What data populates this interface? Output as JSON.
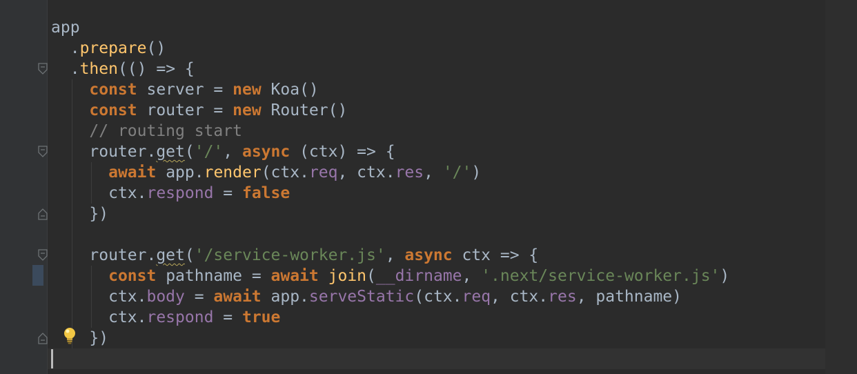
{
  "editor": {
    "theme_colors": {
      "background": "#2b2b2b",
      "gutter": "#313335",
      "keyword": "#cc7832",
      "function": "#ffc66d",
      "string": "#6a8759",
      "property": "#9876aa",
      "comment": "#808080",
      "default": "#a9b7c6"
    },
    "lines": [
      {
        "indent": "",
        "tokens": [
          {
            "t": "app",
            "c": ""
          }
        ]
      },
      {
        "indent": "  ",
        "tokens": [
          {
            "t": ".",
            "c": ""
          },
          {
            "t": "prepare",
            "c": "fn"
          },
          {
            "t": "()",
            "c": ""
          }
        ]
      },
      {
        "indent": "  ",
        "tokens": [
          {
            "t": ".",
            "c": ""
          },
          {
            "t": "then",
            "c": "fn"
          },
          {
            "t": "(() => {",
            "c": ""
          }
        ]
      },
      {
        "indent": "    ",
        "tokens": [
          {
            "t": "const",
            "c": "kw"
          },
          {
            "t": " server = ",
            "c": ""
          },
          {
            "t": "new",
            "c": "kw"
          },
          {
            "t": " Koa()",
            "c": ""
          }
        ]
      },
      {
        "indent": "    ",
        "tokens": [
          {
            "t": "const",
            "c": "kw"
          },
          {
            "t": " router = ",
            "c": ""
          },
          {
            "t": "new",
            "c": "kw"
          },
          {
            "t": " Router()",
            "c": ""
          }
        ]
      },
      {
        "indent": "    ",
        "tokens": [
          {
            "t": "// routing start",
            "c": "cm"
          }
        ]
      },
      {
        "indent": "    ",
        "tokens": [
          {
            "t": "router.",
            "c": ""
          },
          {
            "t": "get",
            "c": "squig"
          },
          {
            "t": "(",
            "c": ""
          },
          {
            "t": "'/'",
            "c": "str"
          },
          {
            "t": ", ",
            "c": ""
          },
          {
            "t": "async",
            "c": "kw"
          },
          {
            "t": " (ctx) => {",
            "c": ""
          }
        ]
      },
      {
        "indent": "      ",
        "tokens": [
          {
            "t": "await",
            "c": "kw"
          },
          {
            "t": " app.",
            "c": ""
          },
          {
            "t": "render",
            "c": "fn"
          },
          {
            "t": "(ctx.",
            "c": ""
          },
          {
            "t": "req",
            "c": "prop"
          },
          {
            "t": ", ctx.",
            "c": ""
          },
          {
            "t": "res",
            "c": "prop"
          },
          {
            "t": ", ",
            "c": ""
          },
          {
            "t": "'/'",
            "c": "str"
          },
          {
            "t": ")",
            "c": ""
          }
        ]
      },
      {
        "indent": "      ",
        "tokens": [
          {
            "t": "ctx.",
            "c": ""
          },
          {
            "t": "respond",
            "c": "prop"
          },
          {
            "t": " = ",
            "c": ""
          },
          {
            "t": "false",
            "c": "kw"
          }
        ]
      },
      {
        "indent": "    ",
        "tokens": [
          {
            "t": "})",
            "c": ""
          }
        ]
      },
      {
        "indent": "",
        "tokens": [
          {
            "t": "",
            "c": ""
          }
        ]
      },
      {
        "indent": "    ",
        "tokens": [
          {
            "t": "router.",
            "c": ""
          },
          {
            "t": "get",
            "c": "squig"
          },
          {
            "t": "(",
            "c": ""
          },
          {
            "t": "'/service-worker.js'",
            "c": "str"
          },
          {
            "t": ", ",
            "c": ""
          },
          {
            "t": "async",
            "c": "kw"
          },
          {
            "t": " ctx => {",
            "c": ""
          }
        ]
      },
      {
        "indent": "      ",
        "tokens": [
          {
            "t": "const",
            "c": "kw"
          },
          {
            "t": " pathname = ",
            "c": ""
          },
          {
            "t": "await",
            "c": "kw"
          },
          {
            "t": " ",
            "c": ""
          },
          {
            "t": "join",
            "c": "fn"
          },
          {
            "t": "(",
            "c": ""
          },
          {
            "t": "__dirname",
            "c": "prop"
          },
          {
            "t": ", ",
            "c": ""
          },
          {
            "t": "'.next/service-worker.js'",
            "c": "str"
          },
          {
            "t": ")",
            "c": ""
          }
        ]
      },
      {
        "indent": "      ",
        "tokens": [
          {
            "t": "ctx.",
            "c": ""
          },
          {
            "t": "body",
            "c": "prop"
          },
          {
            "t": " = ",
            "c": ""
          },
          {
            "t": "await",
            "c": "kw"
          },
          {
            "t": " app.",
            "c": ""
          },
          {
            "t": "serveStatic",
            "c": "prop"
          },
          {
            "t": "(ctx.",
            "c": ""
          },
          {
            "t": "req",
            "c": "prop"
          },
          {
            "t": ", ctx.",
            "c": ""
          },
          {
            "t": "res",
            "c": "prop"
          },
          {
            "t": ", pathname)",
            "c": ""
          }
        ]
      },
      {
        "indent": "      ",
        "tokens": [
          {
            "t": "ctx.",
            "c": ""
          },
          {
            "t": "respond",
            "c": "prop"
          },
          {
            "t": " = ",
            "c": ""
          },
          {
            "t": "true",
            "c": "kw"
          }
        ]
      },
      {
        "indent": "    ",
        "tokens": [
          {
            "t": "})",
            "c": ""
          }
        ]
      }
    ],
    "gutter_markers": [
      {
        "line": 2,
        "icon": "fold-open-icon"
      },
      {
        "line": 6,
        "icon": "fold-open-icon"
      },
      {
        "line": 9,
        "icon": "fold-close-icon"
      },
      {
        "line": 11,
        "icon": "fold-open-icon"
      },
      {
        "line": 15,
        "icon": "fold-close-icon"
      }
    ],
    "intention_icon": "lightbulb-icon"
  }
}
